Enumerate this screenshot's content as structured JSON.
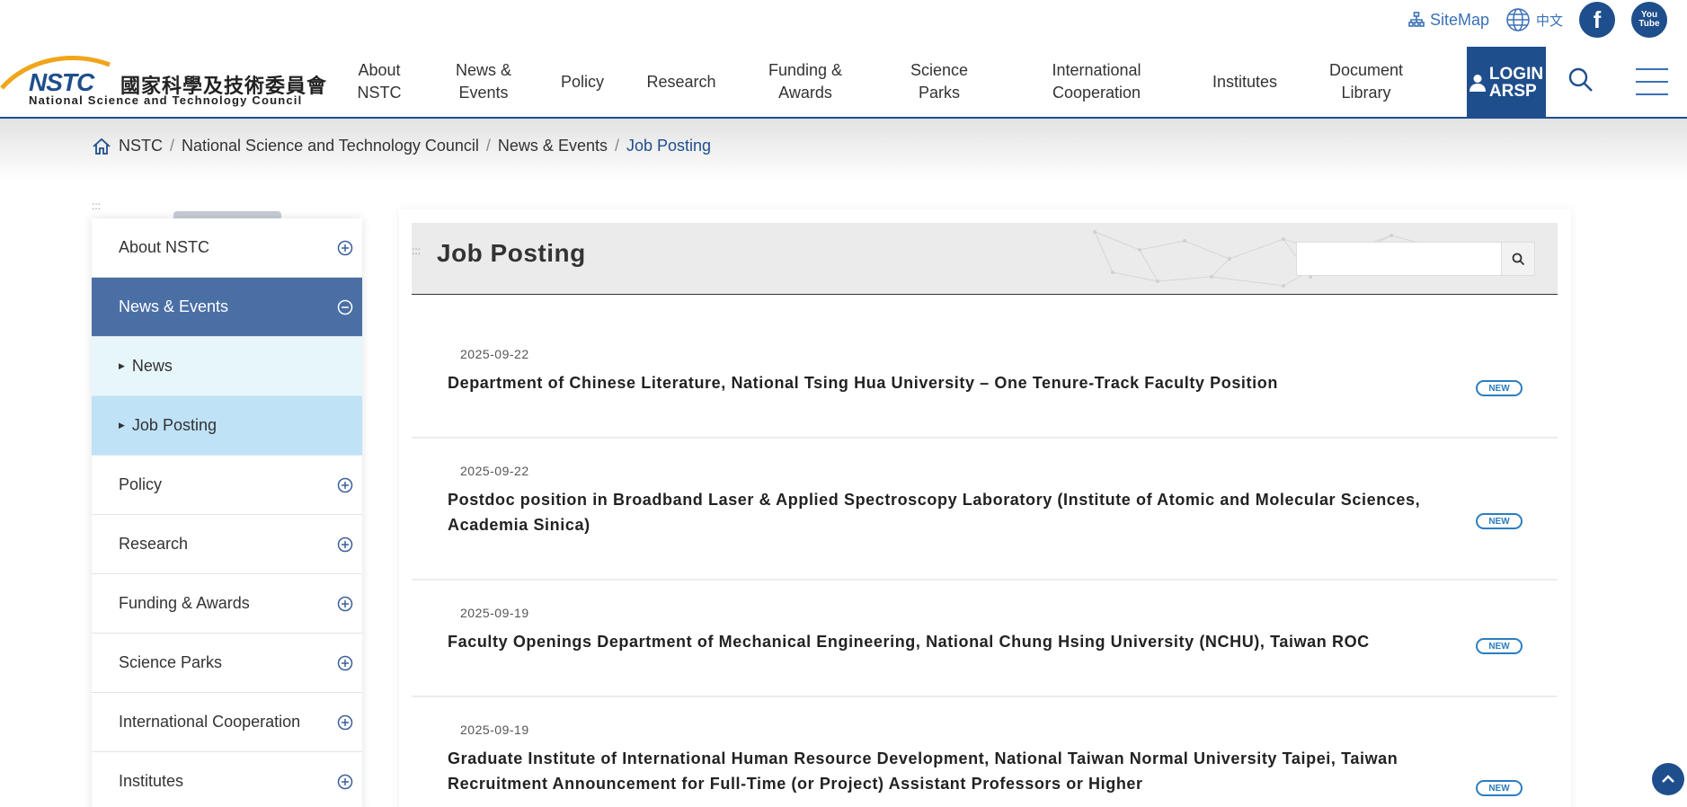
{
  "header": {
    "utility": {
      "sitemap_label": "SiteMap",
      "language_label": "中文"
    },
    "logo": {
      "short": "NSTC",
      "chinese": "國家科學及技術委員會",
      "english": "National Science and Technology Council"
    },
    "nav": [
      {
        "line1": "About",
        "line2": "NSTC"
      },
      {
        "line1": "News &",
        "line2": "Events"
      },
      {
        "line1": "Policy",
        "line2": ""
      },
      {
        "line1": "Research",
        "line2": ""
      },
      {
        "line1": "Funding &",
        "line2": "Awards"
      },
      {
        "line1": "Science",
        "line2": "Parks"
      },
      {
        "line1": "International",
        "line2": "Cooperation"
      },
      {
        "line1": "Institutes",
        "line2": ""
      },
      {
        "line1": "Document",
        "line2": "Library"
      }
    ],
    "login": {
      "line1": "LOGIN",
      "line2": "ARSP"
    },
    "colors": {
      "primary": "#1f4e8c",
      "link": "#3a70b8"
    }
  },
  "breadcrumb": {
    "items": [
      "NSTC",
      "National Science and Technology Council",
      "News & Events"
    ],
    "current": "Job Posting"
  },
  "sidebar": {
    "items": [
      {
        "label": "About NSTC"
      },
      {
        "label": "News & Events"
      },
      {
        "label": "Policy"
      },
      {
        "label": "Research"
      },
      {
        "label": "Funding & Awards"
      },
      {
        "label": "Science Parks"
      },
      {
        "label": "International Cooperation"
      },
      {
        "label": "Institutes"
      }
    ],
    "subitems": [
      {
        "label": "News"
      },
      {
        "label": "Job Posting"
      }
    ],
    "active_color": "#4a6fa5"
  },
  "main": {
    "title": "Job Posting",
    "search": {
      "value": ""
    },
    "posts": [
      {
        "date": "2025-09-22",
        "title": "Department of Chinese Literature, National Tsing Hua University – One Tenure-Track Faculty Position",
        "badge": "NEW"
      },
      {
        "date": "2025-09-22",
        "title": "Postdoc position in Broadband Laser & Applied Spectroscopy Laboratory (Institute of Atomic and Molecular Sciences, Academia Sinica)",
        "badge": "NEW"
      },
      {
        "date": "2025-09-19",
        "title": "Faculty Openings Department of Mechanical Engineering, National Chung Hsing University (NCHU), Taiwan ROC",
        "badge": "NEW"
      },
      {
        "date": "2025-09-19",
        "title": "Graduate Institute of International Human Resource Development, National Taiwan Normal University Taipei, Taiwan Recruitment Announcement for Full-Time (or Project) Assistant Professors or Higher",
        "badge": "NEW"
      }
    ]
  }
}
